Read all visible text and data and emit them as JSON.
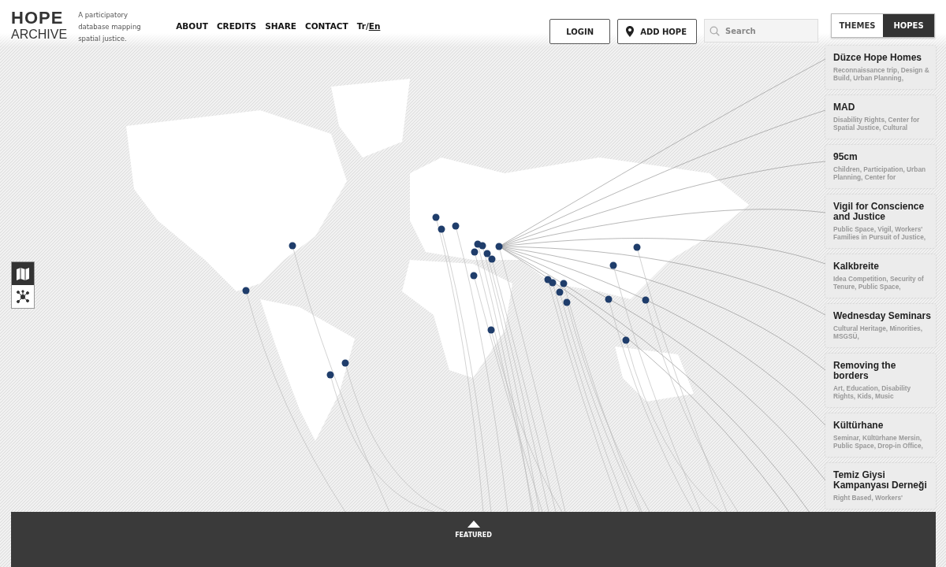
{
  "logo": {
    "line_1": "HOPE",
    "line_2": "ARCHIVE"
  },
  "tagline": "A participatory database mapping spatial justice.",
  "nav": [
    {
      "label": "ABOUT"
    },
    {
      "label": "CREDITS"
    },
    {
      "label": "SHARE"
    },
    {
      "label": "CONTACT"
    }
  ],
  "languages": {
    "separator": "/",
    "items": [
      {
        "label": "Tr",
        "selected": false
      },
      {
        "label": "En",
        "selected": true
      }
    ]
  },
  "buttons": {
    "login": "LOGIN",
    "add": "ADD HOPE"
  },
  "search": {
    "placeholder": "Search"
  },
  "view_tabs": [
    {
      "label": "THEMES",
      "selected": false
    },
    {
      "label": "HOPES",
      "selected": true
    }
  ],
  "map_modes": [
    {
      "kind": "map",
      "selected": true
    },
    {
      "kind": "network",
      "selected": false
    }
  ],
  "hopes": [
    {
      "title": "Düzce Hope Homes",
      "tags": "Reconnaissance trip, Design & Build, Urban Planning,"
    },
    {
      "title": "MAD",
      "tags": "Disability Rights, Center for Spatial Justice, Cultural"
    },
    {
      "title": "95cm",
      "tags": "Children, Participation, Urban Planning, Center for"
    },
    {
      "title": "Vigil for Conscience and Justice",
      "tags": "Public Space, Vigil, Workers' Families in Pursuit of Justice,"
    },
    {
      "title": "Kalkbreite",
      "tags": "Idea Competition, Security of Tenure, Public Space,"
    },
    {
      "title": "Wednesday Seminars",
      "tags": "Cultural Heritage, Minorities, MSGSÜ,"
    },
    {
      "title": "Removing the borders",
      "tags": "Art, Education, Disability Rights, Kids, Music"
    },
    {
      "title": "Kültürhane",
      "tags": "Seminar, Kültürhane Mersin, Public Space, Drop-in Office,"
    },
    {
      "title": "Temiz Giysi Kampanyası Derneği",
      "tags": "Right Based, Workers'"
    }
  ],
  "featured": {
    "label": "FEATURED"
  }
}
